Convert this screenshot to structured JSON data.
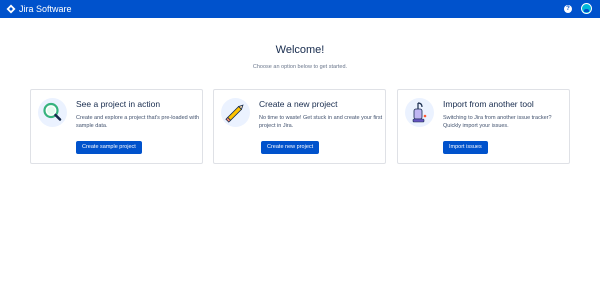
{
  "header": {
    "brand": "Jira Software",
    "icons": [
      "jira-logo-icon",
      "help-icon",
      "avatar"
    ]
  },
  "welcome": {
    "title": "Welcome!",
    "subtitle": "Choose an option below to get started."
  },
  "cards": [
    {
      "icon": "magnifier-icon",
      "title": "See a project in action",
      "description": "Create and explore a project that's pre-loaded with sample data.",
      "button": "Create sample project"
    },
    {
      "icon": "pencil-icon",
      "title": "Create a new project",
      "description": "No time to waste! Get stuck in and create your first project in Jira.",
      "button": "Create new project"
    },
    {
      "icon": "vacuum-icon",
      "title": "Import from another tool",
      "description": "Switching to Jira from another issue tracker? Quickly import your issues.",
      "button": "Import issues"
    }
  ],
  "colors": {
    "topbar": "#0052cc",
    "button": "#0052cc",
    "text": "#172b4d",
    "muted": "#6b778c",
    "border": "#dfe1e6"
  }
}
